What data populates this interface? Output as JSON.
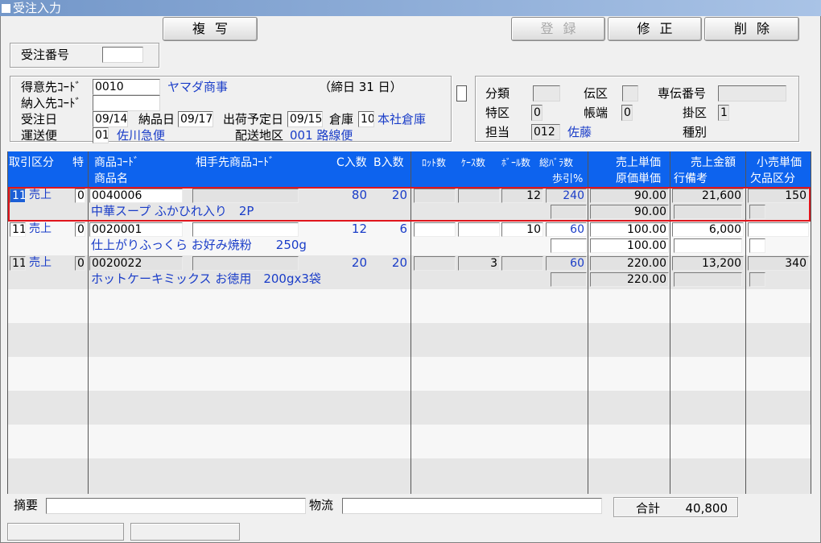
{
  "window": {
    "title": "受注入力"
  },
  "toolbar": {
    "copy": "複写",
    "register": "登録",
    "modify": "修正",
    "delete": "削除"
  },
  "order_no": {
    "label": "受注番号",
    "value": ""
  },
  "customer": {
    "code_label": "得意先ｺｰﾄﾞ",
    "code": "0010",
    "name": "ヤマダ商事",
    "closing": "（締日 31 日）",
    "delivery_label": "納入先ｺｰﾄﾞ",
    "delivery_code": "",
    "order_date_label": "受注日",
    "order_date": "09/14",
    "delivery_date_label": "納品日",
    "delivery_date": "09/17",
    "ship_date_label": "出荷予定日",
    "ship_date": "09/15",
    "warehouse_label": "倉庫",
    "warehouse_code": "10",
    "warehouse_name": "本社倉庫",
    "carrier_label": "運送便",
    "carrier_code": "01",
    "carrier_name": "佐川急便",
    "area_label": "配送地区",
    "area": "001 路線便"
  },
  "right_panel": {
    "class_label": "分類",
    "class_value": "",
    "denku_label": "伝区",
    "denku_value": "",
    "senden_label": "専伝番号",
    "senden_value": "",
    "tokku_label": "特区",
    "tokku_value": "0",
    "chohata_label": "帳端",
    "chohata_value": "0",
    "kake_label": "掛区",
    "kake_value": "1",
    "staff_label": "担当",
    "staff_code": "012",
    "staff_name": "佐藤",
    "type_label": "種別"
  },
  "grid": {
    "headers": {
      "deal": "取引区分",
      "special": "特",
      "item_code": "商品ｺｰﾄﾞ",
      "partner_code": "相手先商品ｺｰﾄﾞ",
      "item_name": "商品名",
      "c_qty": "C入数",
      "b_qty": "B入数",
      "lot": "ﾛｯﾄ数",
      "case": "ｹｰｽ数",
      "ball": "ﾎﾞｰﾙ数",
      "total": "総ﾊﾞﾗ数",
      "yield": "歩引%",
      "sale_price": "売上単価",
      "cost_price": "原価単価",
      "sale_amount": "売上金額",
      "line_note": "行備考",
      "retail_price": "小売単価",
      "shortage": "欠品区分"
    },
    "rows": [
      {
        "deal_code": "11",
        "deal_name": "売上",
        "special": "0",
        "item_code": "0040006",
        "partner_code": "",
        "item_name": "中華スープ ふかひれ入り　2P",
        "c_qty": "80",
        "b_qty": "20",
        "lot": "",
        "case": "",
        "ball": "12",
        "total": "240",
        "yield": "",
        "sale_price": "90.00",
        "cost_price": "90.00",
        "sale_amount": "21,600",
        "line_note": "",
        "retail_price": "150",
        "shortage": ""
      },
      {
        "deal_code": "11",
        "deal_name": "売上",
        "special": "0",
        "item_code": "0020001",
        "partner_code": "",
        "item_name": "仕上がりふっくら お好み焼粉　　250g",
        "c_qty": "12",
        "b_qty": "6",
        "lot": "",
        "case": "",
        "ball": "10",
        "total": "60",
        "yield": "",
        "sale_price": "100.00",
        "cost_price": "100.00",
        "sale_amount": "6,000",
        "line_note": "",
        "retail_price": "",
        "shortage": ""
      },
      {
        "deal_code": "11",
        "deal_name": "売上",
        "special": "0",
        "item_code": "0020022",
        "partner_code": "",
        "item_name": "ホットケーキミックス お徳用　200gx3袋",
        "c_qty": "20",
        "b_qty": "20",
        "lot": "",
        "case": "3",
        "ball": "",
        "total": "60",
        "yield": "",
        "sale_price": "220.00",
        "cost_price": "220.00",
        "sale_amount": "13,200",
        "line_note": "",
        "retail_price": "340",
        "shortage": ""
      }
    ]
  },
  "footer": {
    "summary_label": "摘要",
    "summary": "",
    "logistics_label": "物流",
    "logistics": "",
    "total_label": "合計",
    "total": "40,800"
  },
  "colors": {
    "header_blue": "#0d63ee",
    "value_blue": "#1a3dc8",
    "selection_red": "#e0151c"
  }
}
